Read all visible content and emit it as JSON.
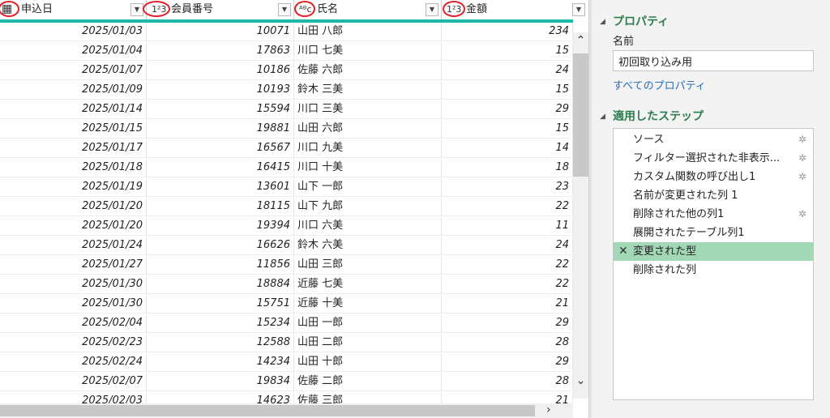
{
  "columns": [
    {
      "type_icon": "▦",
      "label": "申込日"
    },
    {
      "type_icon": "1²3",
      "label": "会員番号"
    },
    {
      "type_icon": "ᴬᴮc",
      "label": "氏名"
    },
    {
      "type_icon": "1²3",
      "label": "金額"
    }
  ],
  "rows": [
    {
      "date": "2025/01/03",
      "id": "10071",
      "name": "山田 八郎",
      "amt": "234"
    },
    {
      "date": "2025/01/04",
      "id": "17863",
      "name": "川口 七美",
      "amt": "15"
    },
    {
      "date": "2025/01/07",
      "id": "10186",
      "name": "佐藤 六郎",
      "amt": "24"
    },
    {
      "date": "2025/01/09",
      "id": "10193",
      "name": "鈴木 三美",
      "amt": "15"
    },
    {
      "date": "2025/01/14",
      "id": "15594",
      "name": "川口 三美",
      "amt": "29"
    },
    {
      "date": "2025/01/15",
      "id": "19881",
      "name": "山田 六郎",
      "amt": "15"
    },
    {
      "date": "2025/01/17",
      "id": "16567",
      "name": "川口 九美",
      "amt": "14"
    },
    {
      "date": "2025/01/18",
      "id": "16415",
      "name": "川口 十美",
      "amt": "18"
    },
    {
      "date": "2025/01/19",
      "id": "13601",
      "name": "山下 一郎",
      "amt": "23"
    },
    {
      "date": "2025/01/20",
      "id": "18115",
      "name": "山下 九郎",
      "amt": "22"
    },
    {
      "date": "2025/01/20",
      "id": "19394",
      "name": "川口 六美",
      "amt": "11"
    },
    {
      "date": "2025/01/24",
      "id": "16626",
      "name": "鈴木 六美",
      "amt": "24"
    },
    {
      "date": "2025/01/27",
      "id": "11856",
      "name": "山田 三郎",
      "amt": "22"
    },
    {
      "date": "2025/01/30",
      "id": "18884",
      "name": "近藤 七美",
      "amt": "22"
    },
    {
      "date": "2025/01/30",
      "id": "15751",
      "name": "近藤 十美",
      "amt": "21"
    },
    {
      "date": "2025/02/04",
      "id": "15234",
      "name": "山田 一郎",
      "amt": "29"
    },
    {
      "date": "2025/02/23",
      "id": "12588",
      "name": "山田 二郎",
      "amt": "28"
    },
    {
      "date": "2025/02/24",
      "id": "14234",
      "name": "山田 十郎",
      "amt": "29"
    },
    {
      "date": "2025/02/07",
      "id": "19834",
      "name": "佐藤 二郎",
      "amt": "28"
    },
    {
      "date": "2025/02/03",
      "id": "14623",
      "name": "佐藤 三郎",
      "amt": "21"
    }
  ],
  "scroll": {
    "up": "⌃",
    "down": "⌄",
    "right": "›"
  },
  "properties": {
    "title": "プロパティ",
    "name_label": "名前",
    "name_value": "初回取り込み用",
    "all_props": "すべてのプロパティ"
  },
  "applied_steps": {
    "title": "適用したステップ",
    "items": [
      {
        "label": "ソース",
        "gear": true
      },
      {
        "label": "フィルター選択された非表示...",
        "gear": true
      },
      {
        "label": "カスタム関数の呼び出し1",
        "gear": true
      },
      {
        "label": "名前が変更された列 1",
        "gear": false
      },
      {
        "label": "削除された他の列1",
        "gear": true
      },
      {
        "label": "展開されたテーブル列1",
        "gear": false
      },
      {
        "label": "変更された型",
        "gear": false,
        "selected": true
      },
      {
        "label": "削除された列",
        "gear": false
      }
    ]
  },
  "colors": {
    "accent_teal": "#1fb7a6",
    "selected_step": "#a2d8b6",
    "section_title": "#2e7d4f",
    "link": "#2a6fb6",
    "highlight_ring": "#e0222a"
  }
}
